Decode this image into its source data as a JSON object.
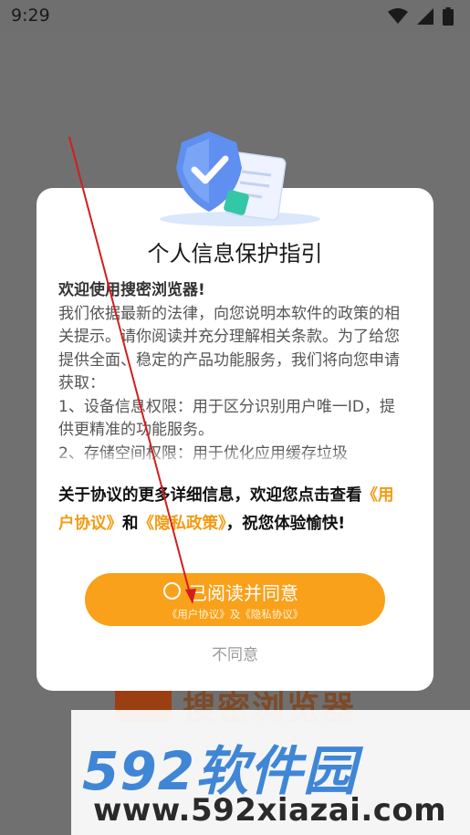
{
  "status_bar": {
    "time": "9:29"
  },
  "dialog": {
    "title": "个人信息保护指引",
    "greeting": "欢迎使用搜密浏览器!",
    "paragraph": "我们依据最新的法律，向您说明本软件的政策的相关提示。请你阅读并充分理解相关条款。为了给您提供全面、稳定的产品功能服务，我们将向您申请获取：",
    "item1": "1、设备信息权限：用于区分识别用户唯一ID，提供更精准的功能服务。",
    "item2": "2、存储空间权限：用于优化应用缓存垃圾",
    "agreement_intro": "关于协议的更多详细信息，欢迎您点击查看",
    "user_agreement_link": "《用户协议》",
    "and": "和",
    "privacy_policy_link": "《隐私政策》",
    "agreement_outro": "，祝您体验愉快!",
    "agree_label": "已阅读并同意",
    "agree_sublabel": "《用户协议》及《隐私协议》",
    "decline_label": "不同意"
  },
  "background": {
    "brand_name": "搜密浏览器"
  },
  "watermark": {
    "title": "592软件园",
    "url": "www.592xiazai.com"
  },
  "colors": {
    "accent": "#f9a11a",
    "link": "#f39a12",
    "shield": "#5f8ff0",
    "watermark_blue": "#3f86d6",
    "annotation_arrow": "#d41d1d"
  }
}
